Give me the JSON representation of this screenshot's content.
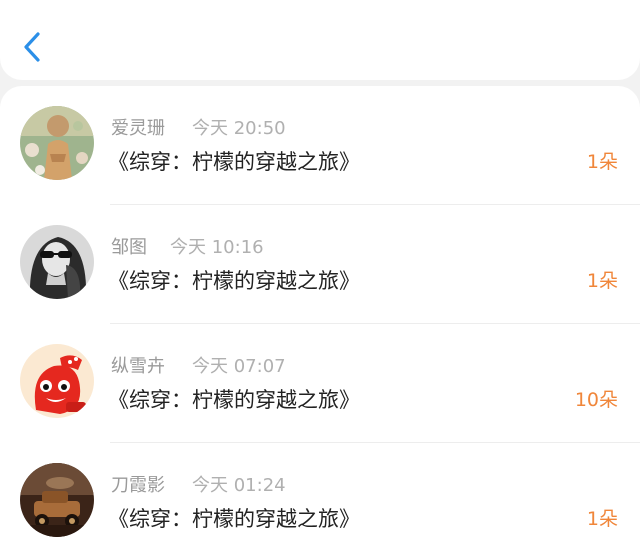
{
  "header": {
    "back_icon": "chevron-left-icon",
    "accent_color": "#2b8fe8"
  },
  "records": [
    {
      "name": "爱灵珊",
      "time": "今天 20:50",
      "title": "《综穿：柠檬的穿越之旅》",
      "amount": "1朵",
      "avatar": "avatar-photo-girl-flowers"
    },
    {
      "name": "邹图",
      "time": "今天 10:16",
      "title": "《综穿：柠檬的穿越之旅》",
      "amount": "1朵",
      "avatar": "avatar-photo-woman-sunglasses"
    },
    {
      "name": "纵雪卉",
      "time": "今天 07:07",
      "title": "《综穿：柠檬的穿越之旅》",
      "amount": "10朵",
      "avatar": "avatar-red-cartoon-character"
    },
    {
      "name": "刀霞影",
      "time": "今天 01:24",
      "title": "《综穿：柠檬的穿越之旅》",
      "amount": "1朵",
      "avatar": "avatar-photo-vintage-car"
    }
  ],
  "colors": {
    "amount": "#f0863a",
    "name": "#9a9a9a",
    "title": "#222222",
    "background": "#f2f2f2"
  }
}
